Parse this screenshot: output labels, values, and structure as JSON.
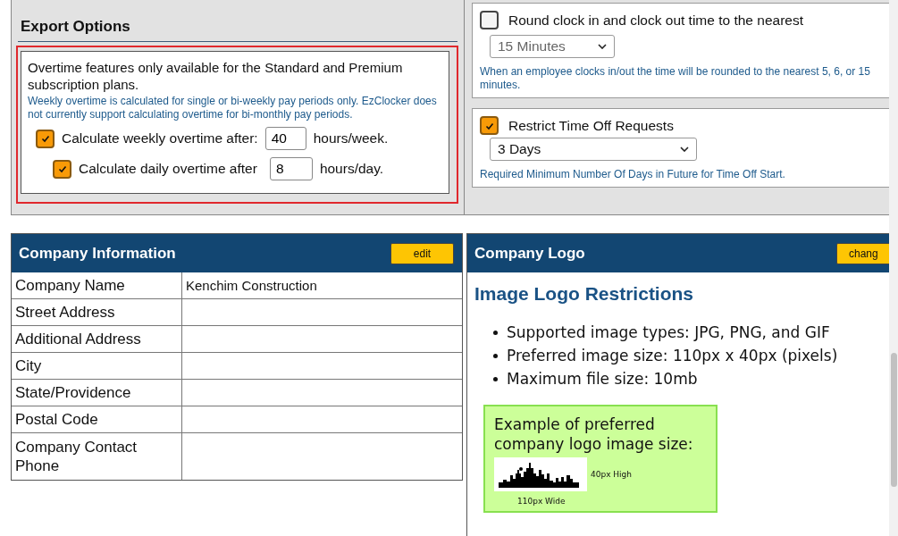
{
  "export_options": {
    "title": "Export Options",
    "notice": "Overtime features only available for the Standard and Premium subscription plans.",
    "note": "Weekly overtime is calculated for single or bi-weekly pay periods only. EzClocker does not currently support calculating overtime for bi-monthly pay periods.",
    "options": [
      {
        "label": "Calculate weekly overtime after:",
        "value": "40",
        "unit": "hours/week.",
        "checked": true
      },
      {
        "label": "Calculate daily overtime after",
        "value": "8",
        "unit": "hours/day.",
        "checked": true
      }
    ]
  },
  "rounding": {
    "label": "Round clock in and clock out time to the nearest",
    "checked": false,
    "select": "15 Minutes",
    "disabled": true,
    "note": "When an employee clocks in/out the time will be rounded to the nearest 5, 6, or 15 minutes."
  },
  "time_off": {
    "label": "Restrict Time Off Requests",
    "checked": true,
    "select": "3 Days",
    "disabled": false,
    "note": "Required Minimum Number Of Days in Future for Time Off Start."
  },
  "company_information": {
    "title": "Company Information",
    "button": "edit",
    "rows": [
      {
        "label": "Company Name",
        "value": "Kenchim Construction"
      },
      {
        "label": "Street Address"
      },
      {
        "label": "Additional Address"
      },
      {
        "label": "City"
      },
      {
        "label": "State/Providence"
      },
      {
        "label": "Postal Code"
      },
      {
        "label": "Company Contact Phone"
      }
    ]
  },
  "company_logo": {
    "title": "Company Logo",
    "button": "chang",
    "heading": "Image Logo Restrictions",
    "restrictions": [
      "Supported image types: JPG, PNG, and GIF",
      "Preferred image size: 110px x 40px (pixels)",
      "Maximum file size: 10mb"
    ],
    "example": {
      "caption": "Example of preferred company logo image size:",
      "height_label": "40px High",
      "width_label": "110px Wide"
    }
  }
}
